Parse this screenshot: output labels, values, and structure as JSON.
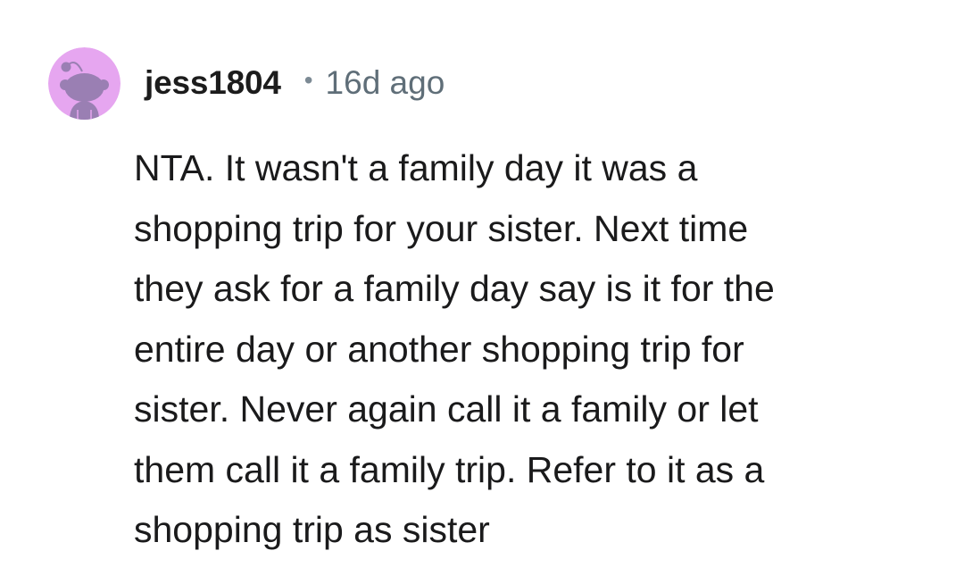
{
  "comment": {
    "author": "jess1804",
    "separator": "•",
    "timestamp": "16d ago",
    "avatar_icon": "reddit-snoo-avatar-icon",
    "avatar_bg": "#e6a6f0",
    "avatar_fg": "#9a7fb3",
    "body_lines": [
      "NTA. It wasn't a family day it was a",
      "shopping trip for your sister. Next time",
      "they ask for a family day say is it for the",
      "entire day or another shopping trip for",
      "sister. Never again call it a family or let",
      "them call it a family trip. Refer to it as a",
      "shopping trip as sister"
    ]
  }
}
